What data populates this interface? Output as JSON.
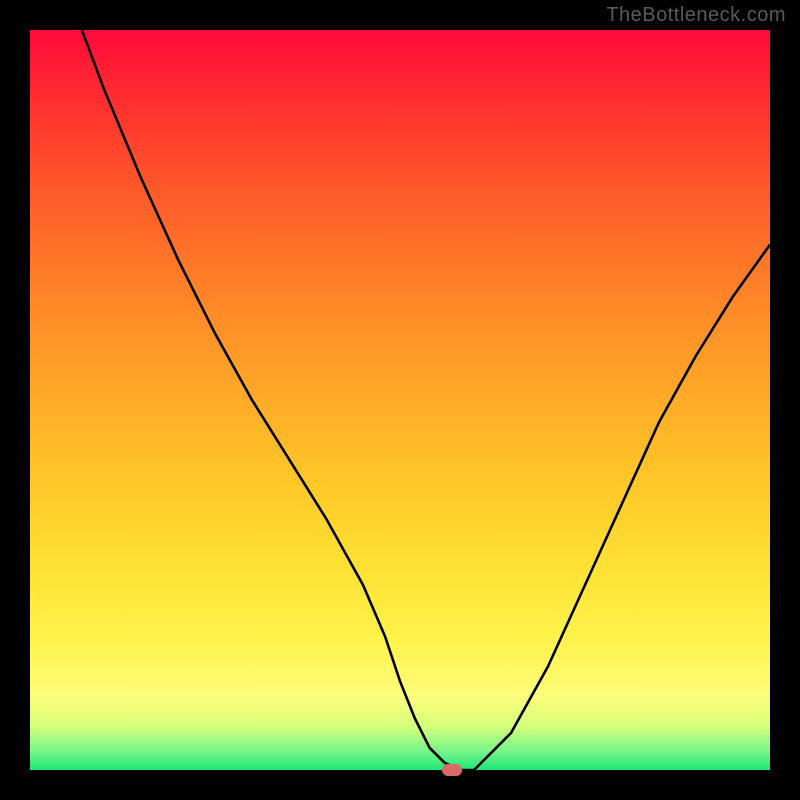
{
  "watermark": "TheBottleneck.com",
  "chart_data": {
    "type": "line",
    "title": "",
    "xlabel": "",
    "ylabel": "",
    "xlim": [
      0,
      100
    ],
    "ylim": [
      0,
      100
    ],
    "grid": false,
    "legend": false,
    "series": [
      {
        "name": "curve",
        "x": [
          7,
          10,
          15,
          20,
          25,
          30,
          35,
          40,
          45,
          48,
          50,
          52,
          54,
          56,
          58,
          60,
          65,
          70,
          75,
          80,
          85,
          90,
          95,
          100
        ],
        "values": [
          100,
          92,
          80,
          69,
          59,
          50,
          42,
          34,
          25,
          18,
          12,
          7,
          3,
          1,
          0,
          0,
          5,
          14,
          25,
          36,
          47,
          56,
          64,
          71
        ]
      }
    ],
    "annotations": [
      {
        "name": "minimum-marker",
        "x": 57,
        "y": 0,
        "color": "#d96a6a",
        "shape": "rounded-rect"
      }
    ],
    "background": {
      "type": "vertical-gradient",
      "stops": [
        {
          "pos": 0.0,
          "color": "#ff0a3a"
        },
        {
          "pos": 0.35,
          "color": "#ff8228"
        },
        {
          "pos": 0.72,
          "color": "#ffe033"
        },
        {
          "pos": 0.92,
          "color": "#fdfd7a"
        },
        {
          "pos": 1.0,
          "color": "#1ee876"
        }
      ]
    }
  }
}
